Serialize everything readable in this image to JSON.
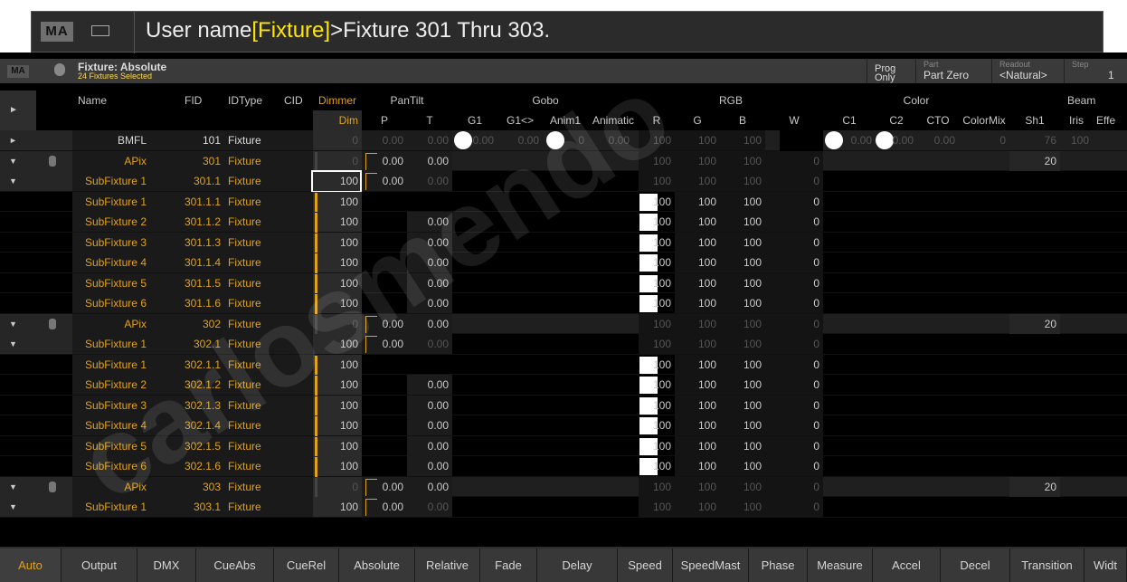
{
  "command_line": {
    "logo": "MA",
    "prefix": "User name",
    "highlight": "[Fixture]",
    "suffix": ">Fixture 301 Thru 303."
  },
  "window": {
    "logo": "MA",
    "title": "Fixture: Absolute",
    "subtitle": "24 Fixtures Selected",
    "prog_label": "Prog Only",
    "part_label": "Part",
    "part_value": "Part Zero",
    "readout_label": "Readout",
    "readout_value": "<Natural>",
    "step_label": "Step",
    "step_value": "1"
  },
  "columns": {
    "name": "Name",
    "fid": "FID",
    "idtype": "IDType",
    "cid": "CID",
    "dimmer": "Dimmer",
    "dim": "Dim",
    "pantilt": "PanTilt",
    "p": "P",
    "t": "T",
    "gobo": "Gobo",
    "g1": "G1",
    "g1r": "G1<>",
    "anim1": "Anim1",
    "animatic": "Animatic",
    "rgb": "RGB",
    "r": "R",
    "g": "G",
    "b": "B",
    "w": "W",
    "color": "Color",
    "c1": "C1",
    "c2": "C2",
    "cto": "CTO",
    "colormix": "ColorMix",
    "beam": "Beam",
    "sh1": "Sh1",
    "iris": "Iris",
    "effect": "Effe"
  },
  "rows": [
    {
      "kind": "bmfl",
      "name": "BMFL",
      "fid": "101",
      "idtype": "Fixture",
      "dim": "0",
      "p": "0.00",
      "t": "0.00",
      "g1": "0.00",
      "g1r": "0.00",
      "anim1": "0",
      "animatic": "0.00",
      "r": "100",
      "g": "100",
      "b": "100",
      "c1": "0.00",
      "c2": "0.00",
      "cto": "0.00",
      "colormix": "0",
      "sh1": "76",
      "iris": "100"
    },
    {
      "kind": "apix",
      "name": "APix",
      "fid": "301",
      "idtype": "Fixture",
      "dim": "0",
      "p": "0.00",
      "t": "0.00",
      "r": "100",
      "g": "100",
      "b": "100",
      "w": "0",
      "sh1": "20"
    },
    {
      "kind": "sub",
      "name": "SubFixture 1",
      "fid": "301.1",
      "idtype": "Fixture",
      "dim": "100",
      "p": "0.00",
      "t": "0.00",
      "r": "100",
      "g": "100",
      "b": "100",
      "w": "0"
    },
    {
      "kind": "leaf",
      "name": "SubFixture 1",
      "fid": "301.1.1",
      "idtype": "Fixture",
      "dim": "100",
      "t": "",
      "r": "100",
      "g": "100",
      "b": "100",
      "w": "0"
    },
    {
      "kind": "leaf",
      "name": "SubFixture 2",
      "fid": "301.1.2",
      "idtype": "Fixture",
      "dim": "100",
      "t": "0.00",
      "r": "100",
      "g": "100",
      "b": "100",
      "w": "0"
    },
    {
      "kind": "leaf",
      "name": "SubFixture 3",
      "fid": "301.1.3",
      "idtype": "Fixture",
      "dim": "100",
      "t": "0.00",
      "r": "100",
      "g": "100",
      "b": "100",
      "w": "0"
    },
    {
      "kind": "leaf",
      "name": "SubFixture 4",
      "fid": "301.1.4",
      "idtype": "Fixture",
      "dim": "100",
      "t": "0.00",
      "r": "100",
      "g": "100",
      "b": "100",
      "w": "0"
    },
    {
      "kind": "leaf",
      "name": "SubFixture 5",
      "fid": "301.1.5",
      "idtype": "Fixture",
      "dim": "100",
      "t": "0.00",
      "r": "100",
      "g": "100",
      "b": "100",
      "w": "0"
    },
    {
      "kind": "leaf",
      "name": "SubFixture 6",
      "fid": "301.1.6",
      "idtype": "Fixture",
      "dim": "100",
      "t": "0.00",
      "r": "100",
      "g": "100",
      "b": "100",
      "w": "0"
    },
    {
      "kind": "apix",
      "name": "APix",
      "fid": "302",
      "idtype": "Fixture",
      "dim": "0",
      "p": "0.00",
      "t": "0.00",
      "r": "100",
      "g": "100",
      "b": "100",
      "w": "0",
      "sh1": "20"
    },
    {
      "kind": "sub",
      "name": "SubFixture 1",
      "fid": "302.1",
      "idtype": "Fixture",
      "dim": "100",
      "p": "0.00",
      "t": "0.00",
      "r": "100",
      "g": "100",
      "b": "100",
      "w": "0"
    },
    {
      "kind": "leaf",
      "name": "SubFixture 1",
      "fid": "302.1.1",
      "idtype": "Fixture",
      "dim": "100",
      "t": "",
      "r": "100",
      "g": "100",
      "b": "100",
      "w": "0"
    },
    {
      "kind": "leaf",
      "name": "SubFixture 2",
      "fid": "302.1.2",
      "idtype": "Fixture",
      "dim": "100",
      "t": "0.00",
      "r": "100",
      "g": "100",
      "b": "100",
      "w": "0"
    },
    {
      "kind": "leaf",
      "name": "SubFixture 3",
      "fid": "302.1.3",
      "idtype": "Fixture",
      "dim": "100",
      "t": "0.00",
      "r": "100",
      "g": "100",
      "b": "100",
      "w": "0"
    },
    {
      "kind": "leaf",
      "name": "SubFixture 4",
      "fid": "302.1.4",
      "idtype": "Fixture",
      "dim": "100",
      "t": "0.00",
      "r": "100",
      "g": "100",
      "b": "100",
      "w": "0"
    },
    {
      "kind": "leaf",
      "name": "SubFixture 5",
      "fid": "302.1.5",
      "idtype": "Fixture",
      "dim": "100",
      "t": "0.00",
      "r": "100",
      "g": "100",
      "b": "100",
      "w": "0"
    },
    {
      "kind": "leaf",
      "name": "SubFixture 6",
      "fid": "302.1.6",
      "idtype": "Fixture",
      "dim": "100",
      "t": "0.00",
      "r": "100",
      "g": "100",
      "b": "100",
      "w": "0"
    },
    {
      "kind": "apix",
      "name": "APix",
      "fid": "303",
      "idtype": "Fixture",
      "dim": "0",
      "p": "0.00",
      "t": "0.00",
      "r": "100",
      "g": "100",
      "b": "100",
      "w": "0",
      "sh1": "20"
    },
    {
      "kind": "sub",
      "name": "SubFixture 1",
      "fid": "303.1",
      "idtype": "Fixture",
      "dim": "100",
      "p": "0.00",
      "t": "0.00",
      "r": "100",
      "g": "100",
      "b": "100",
      "w": "0"
    }
  ],
  "tabs": [
    "Auto",
    "Output",
    "DMX",
    "CueAbs",
    "CueRel",
    "Absolute",
    "Relative",
    "Fade",
    "Delay",
    "Speed",
    "SpeedMast",
    "Phase",
    "Measure",
    "Accel",
    "Decel",
    "Transition",
    "Widt"
  ],
  "active_tab": "Auto",
  "watermark": "carlosmendo",
  "colors": {
    "accent": "#e0a21a",
    "highlight": "#ffe600",
    "bg": "#000000",
    "panel": "#2b2b2b"
  }
}
